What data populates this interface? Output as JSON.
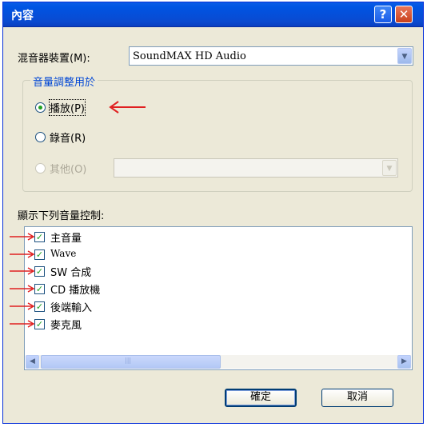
{
  "window": {
    "title": "內容",
    "help_glyph": "?",
    "close_glyph": "✕"
  },
  "mixer": {
    "label": "混音器裝置(M):",
    "value": "SoundMAX HD Audio"
  },
  "volume_group": {
    "label": "音量調整用於",
    "options": [
      {
        "label": "播放(P)",
        "checked": true
      },
      {
        "label": "錄音(R)",
        "checked": false
      },
      {
        "label": "其他(O)",
        "checked": false,
        "disabled": true
      }
    ],
    "other_combo_value": ""
  },
  "controls": {
    "label": "顯示下列音量控制:",
    "items": [
      {
        "label": "主音量",
        "checked": true
      },
      {
        "label": "Wave",
        "checked": true
      },
      {
        "label": "SW 合成",
        "checked": true
      },
      {
        "label": "CD 播放機",
        "checked": true
      },
      {
        "label": "後端輸入",
        "checked": true
      },
      {
        "label": "麥克風",
        "checked": true
      }
    ]
  },
  "buttons": {
    "ok": "確定",
    "cancel": "取消"
  },
  "colors": {
    "annotation_arrow": "#e02020",
    "titlebar": "#0054e3",
    "dialog_bg": "#ece9d8"
  }
}
